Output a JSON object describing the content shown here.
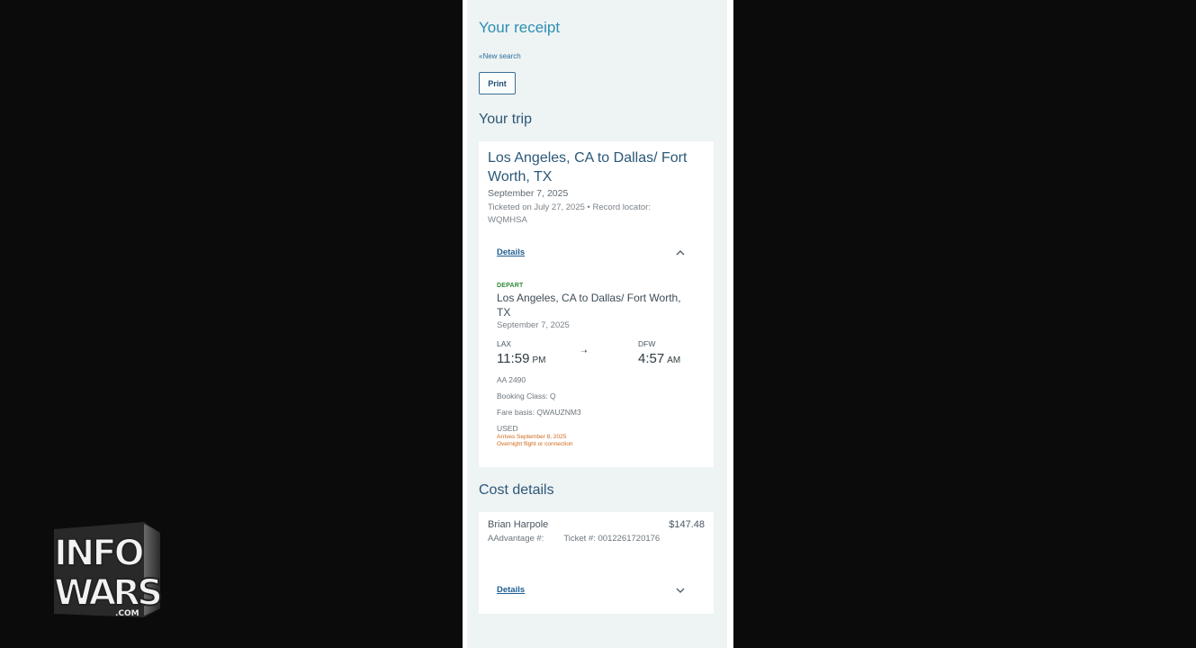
{
  "header": {
    "title": "Your receipt",
    "new_search": "«New search",
    "print_label": "Print"
  },
  "trip": {
    "section_title": "Your trip",
    "title": "Los Angeles, CA to Dallas/ Fort Worth, TX",
    "date": "September 7, 2025",
    "ticketed": "Ticketed on July 27, 2025 • Record locator: WQMHSA",
    "details_label": "Details",
    "segment": {
      "label": "DEPART",
      "route": "Los Angeles, CA to Dallas/ Fort Worth, TX",
      "date": "September 7, 2025",
      "origin_code": "LAX",
      "origin_time": "11:59",
      "origin_ampm": "PM",
      "dest_code": "DFW",
      "dest_time": "4:57",
      "dest_ampm": "AM",
      "flight": "AA 2490",
      "booking_class": "Booking Class: Q",
      "fare_basis": "Fare basis: QWAUZNM3",
      "status": "USED",
      "arrives_note": "Arrives September 8, 2025",
      "overnight_note": "Overnight flight or connection"
    }
  },
  "cost": {
    "section_title": "Cost details",
    "passenger_name": "Brian Harpole",
    "price": "$147.48",
    "aadvantage_label": "AAdvantage #:",
    "ticket_label": "Ticket #: 0012261720176",
    "details_label": "Details"
  },
  "watermark": {
    "logo_text_top": "INFO",
    "logo_text_bottom": "WARS",
    "logo_suffix": ".COM"
  },
  "colors": {
    "background": "#0b0b0b",
    "page": "#eef3f3",
    "accent_blue": "#2d8fb3",
    "depart_green": "#2f8a3b",
    "warning_orange": "#d06a1a"
  }
}
